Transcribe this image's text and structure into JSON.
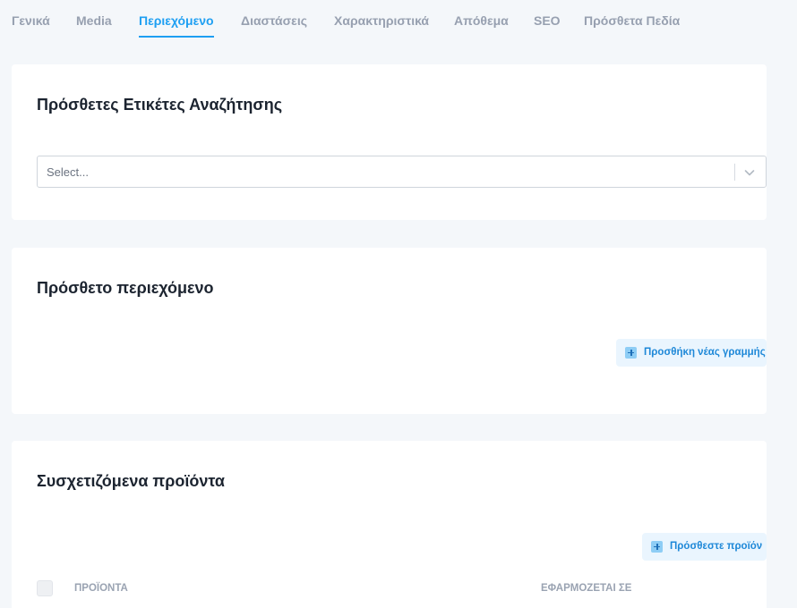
{
  "tabs": [
    {
      "label": "Γενικά"
    },
    {
      "label": "Media"
    },
    {
      "label": "Περιεχόμενο"
    },
    {
      "label": "Διαστάσεις"
    },
    {
      "label": "Χαρακτηριστικά"
    },
    {
      "label": "Απόθεμα"
    },
    {
      "label": "SEO"
    },
    {
      "label": "Πρόσθετα Πεδία"
    }
  ],
  "active_tab": "Περιεχόμενο",
  "colors": {
    "accent": "#1e9ff2",
    "background": "#f4f7fa",
    "card": "#ffffff",
    "muted_text": "#97a0b0",
    "soft_button_bg": "#eaf5fe"
  },
  "search_tags": {
    "title": "Πρόσθετες Ετικέτες Αναζήτησης",
    "select_placeholder": "Select...",
    "chevron_icon": "chevron-down-icon"
  },
  "extra_content": {
    "title": "Πρόσθετο περιεχόμενο",
    "add_row_label": "Προσθήκη νέας γραμμής",
    "add_row_icon": "plus-square-icon"
  },
  "related_products": {
    "title": "Συσχετιζόμενα προϊόντα",
    "add_product_label": "Πρόσθεστε προϊόν",
    "add_product_icon": "plus-square-icon",
    "columns": [
      "ΠΡΟΪΟΝΤΑ",
      "ΕΦΑΡΜΟΖΕΤΑΙ ΣΕ"
    ]
  }
}
